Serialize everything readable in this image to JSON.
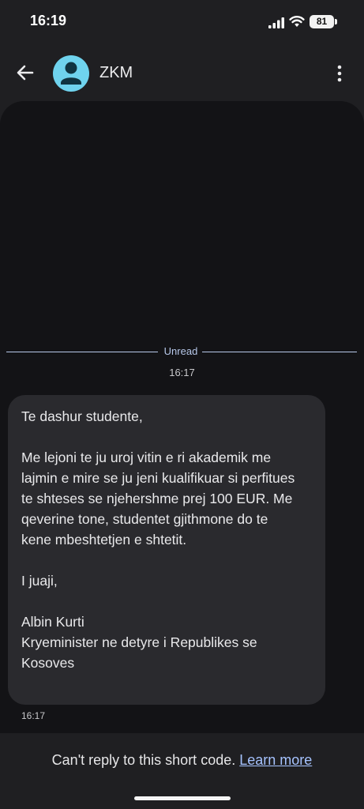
{
  "status_bar": {
    "time": "16:19",
    "battery": "81"
  },
  "header": {
    "contact_name": "ZKM"
  },
  "conversation": {
    "unread_label": "Unread",
    "timestamp_top": "16:17",
    "message_lines": [
      "Te dashur studente,",
      "Me lejoni te ju uroj vitin e ri akademik me",
      "lajmin e mire se ju jeni kualifikuar si perfitues",
      "te shteses se njehershme prej 100 EUR. Me",
      "qeverine tone, studentet gjithmone do te",
      "kene mbeshtetjen e shtetit.",
      "I juaji,",
      "Albin Kurti",
      "Kryeminister ne detyre i Republikes se",
      "Kosoves"
    ],
    "timestamp_bottom": "16:17"
  },
  "footer": {
    "reply_note": "Can't reply to this short code.",
    "learn_more": "Learn more"
  },
  "colors": {
    "accent_link": "#a6c3ff",
    "avatar": "#6fd3ee",
    "unread_line": "#b7c8ea"
  }
}
